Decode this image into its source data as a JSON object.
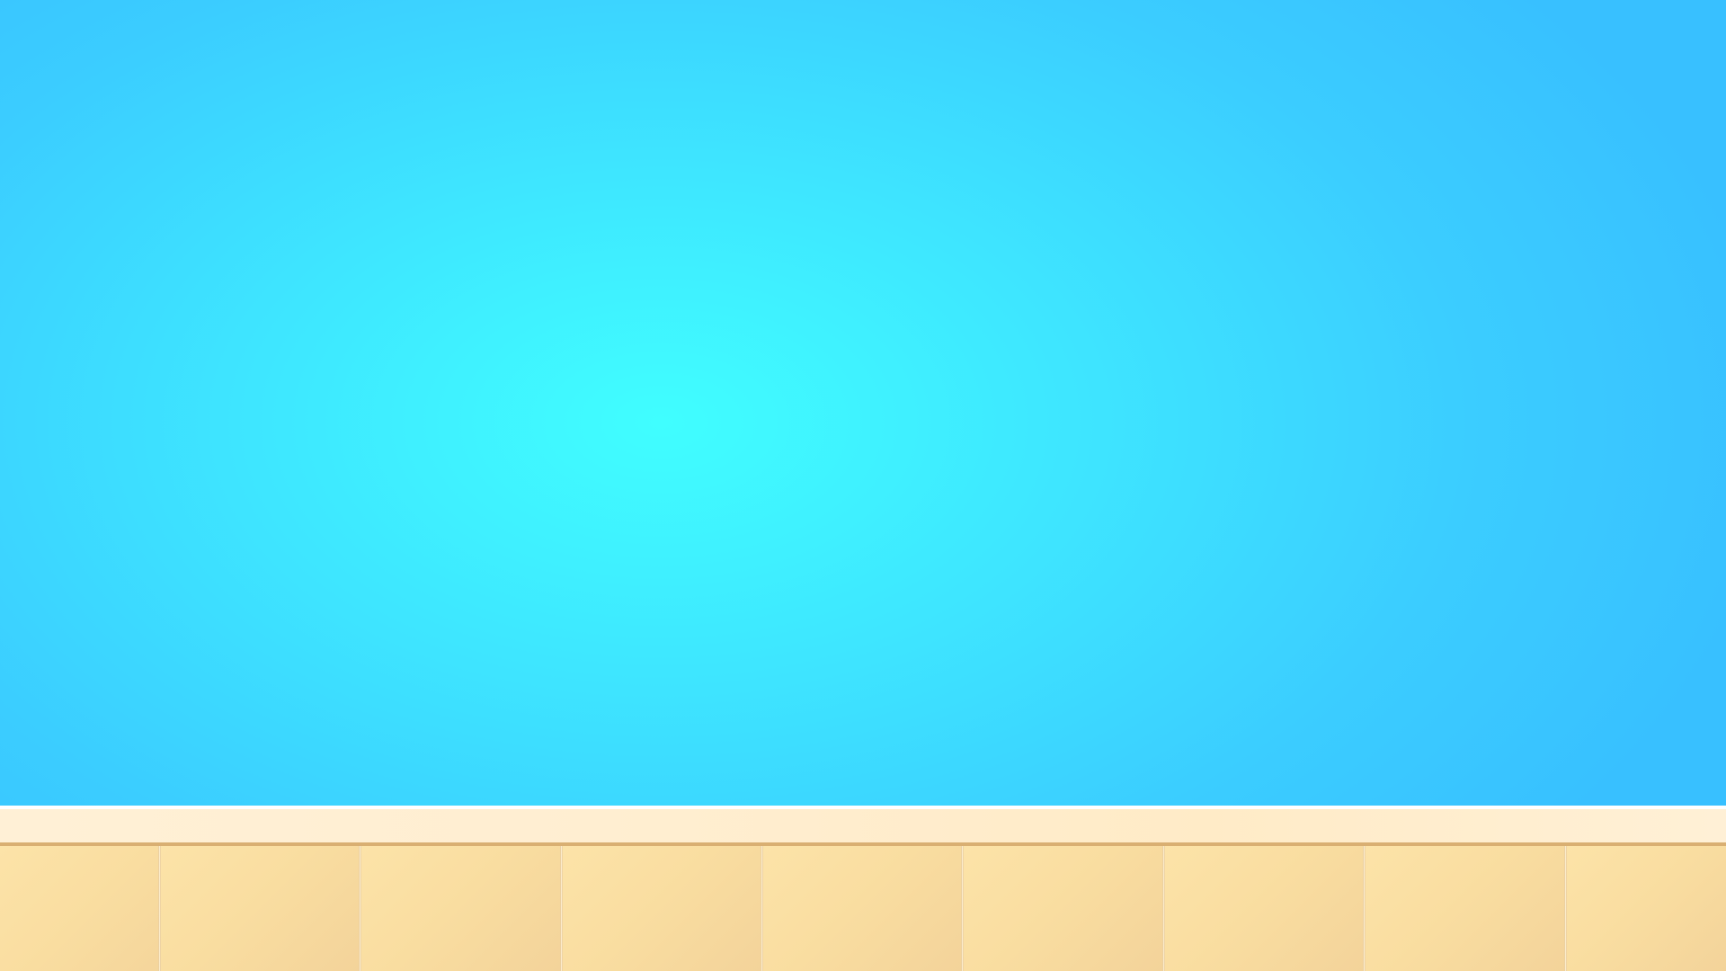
{
  "scene": {
    "name": "kitchen-counter-background",
    "colors": {
      "sky_center": "#40FEFF",
      "sky_edge": "#38C0FF",
      "counter_top": "#FFEED1",
      "counter_lip": "#D9AF72",
      "counter_panel": "#F9DDA0"
    }
  }
}
